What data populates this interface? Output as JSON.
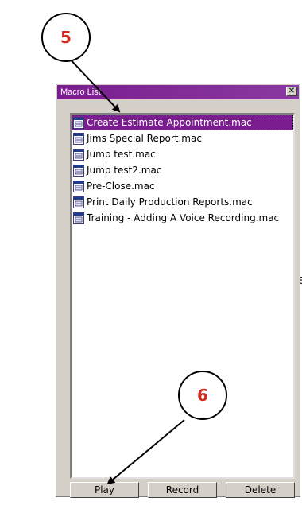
{
  "page_fragment": "te",
  "callouts": {
    "step5": "5",
    "step6": "6"
  },
  "window": {
    "title": "Macro List",
    "close_glyph": "✕"
  },
  "list": {
    "items": [
      "Create Estimate Appointment.mac",
      "Jims Special Report.mac",
      "Jump test.mac",
      "Jump test2.mac",
      "Pre-Close.mac",
      "Print Daily Production Reports.mac",
      "Training - Adding A Voice Recording.mac"
    ],
    "selected_index": 0
  },
  "buttons": {
    "play": "Play",
    "record": "Record",
    "delete": "Delete"
  },
  "colors": {
    "titlebar": "#7a1d8e",
    "selection": "#7a1d8e",
    "callout_text": "#d22a1e"
  },
  "icons": {
    "list_item": "macro-file-icon",
    "close": "close-icon"
  }
}
